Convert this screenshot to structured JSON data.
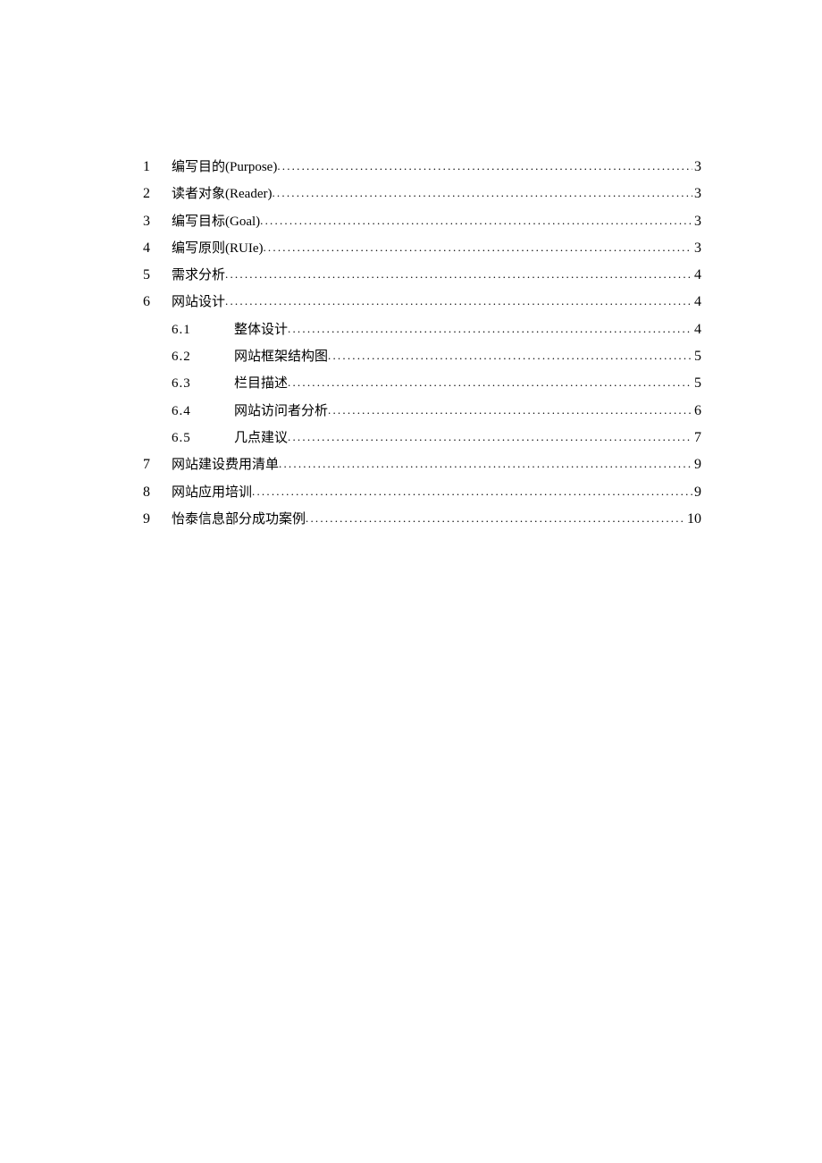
{
  "toc": {
    "entries": [
      {
        "num": "1",
        "title": "编写目的(Purpose)",
        "page": "3",
        "level": 1
      },
      {
        "num": "2",
        "title": "读者对象(Reader)",
        "page": "3",
        "level": 1
      },
      {
        "num": "3",
        "title": "编写目标(Goal)",
        "page": "3",
        "level": 1
      },
      {
        "num": "4",
        "title": "编写原则(RUIe)",
        "page": "3",
        "level": 1
      },
      {
        "num": "5",
        "title": "需求分析 ",
        "page": "4",
        "level": 1
      },
      {
        "num": "6",
        "title": "网站设计 ",
        "page": "4",
        "level": 1
      },
      {
        "num": "6.1",
        "title": "整体设计",
        "page": "4",
        "level": 2
      },
      {
        "num": "6.2",
        "title": "网站框架结构图",
        "page": "5",
        "level": 2
      },
      {
        "num": "6.3",
        "title": "栏目描述",
        "page": "5",
        "level": 2
      },
      {
        "num": "6.4",
        "title": "网站访问者分析",
        "page": "6",
        "level": 2
      },
      {
        "num": "6.5",
        "title": "几点建议",
        "page": "7",
        "level": 2
      },
      {
        "num": "7",
        "title": "网站建设费用清单 ",
        "page": "9",
        "level": 1
      },
      {
        "num": "8",
        "title": "网站应用培训 ",
        "page": "9",
        "level": 1
      },
      {
        "num": "9",
        "title": "怡泰信息部分成功案例 ",
        "page": "10",
        "level": 1
      }
    ]
  }
}
